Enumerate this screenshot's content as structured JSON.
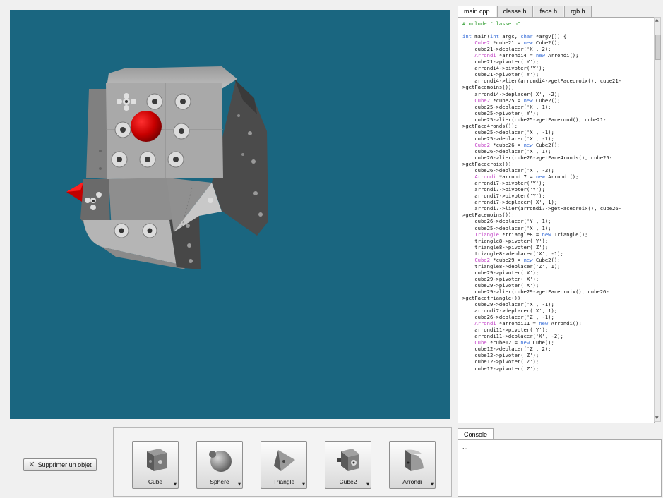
{
  "editor": {
    "tabs": [
      {
        "label": "main.cpp",
        "active": true
      },
      {
        "label": "classe.h",
        "active": false
      },
      {
        "label": "face.h",
        "active": false
      },
      {
        "label": "rgb.h",
        "active": false
      }
    ],
    "code_lines": [
      "#include \"classe.h\"",
      "",
      "int main(int argc, char *argv[]) {",
      "    Cube2 *cube21 = new Cube2();",
      "    cube21->deplacer('X', 2);",
      "    Arrondi *arrondi4 = new Arrondi();",
      "    cube21->pivoter('Y');",
      "    arrondi4->pivoter('Y');",
      "    cube21->pivoter('Y');",
      "    arrondi4->lier(arrondi4->getFacecroix(), cube21-",
      ">getFacemoins());",
      "    arrondi4->deplacer('X', -2);",
      "    Cube2 *cube25 = new Cube2();",
      "    cube25->deplacer('X', 1);",
      "    cube25->pivoter('Y');",
      "    cube25->lier(cube25->getFacerond(), cube21-",
      ">getFace4ronds());",
      "    cube25->deplacer('X', -1);",
      "    cube25->deplacer('X', -1);",
      "    Cube2 *cube26 = new Cube2();",
      "    cube26->deplacer('X', 1);",
      "    cube26->lier(cube26->getFace4ronds(), cube25-",
      ">getFacecroix());",
      "    cube26->deplacer('X', -2);",
      "    Arrondi *arrondi7 = new Arrondi();",
      "    arrondi7->pivoter('Y');",
      "    arrondi7->pivoter('Y');",
      "    arrondi7->pivoter('Y');",
      "    arrondi7->deplacer('X', 1);",
      "    arrondi7->lier(arrondi7->getFacecroix(), cube26-",
      ">getFacemoins());",
      "    cube26->deplacer('Y', 1);",
      "    cube25->deplacer('X', 1);",
      "    Triangle *triangle8 = new Triangle();",
      "    triangle8->pivoter('Y');",
      "    triangle8->pivoter('Z');",
      "    triangle8->deplacer('X', -1);",
      "    Cube2 *cube29 = new Cube2();",
      "    triangle8->deplacer('Z', 1);",
      "    cube29->pivoter('X');",
      "    cube29->pivoter('X');",
      "    cube29->pivoter('X');",
      "    cube29->lier(cube29->getFacecroix(), cube26-",
      ">getFacetriangle());",
      "    cube29->deplacer('X', -1);",
      "    arrondi7->deplacer('X', 1);",
      "    cube26->deplacer('Z', -1);",
      "    Arrondi *arrondi11 = new Arrondi();",
      "    arrondi11->pivoter('Y');",
      "    arrondi11->deplacer('X', -2);",
      "    Cube *cube12 = new Cube();",
      "    cube12->deplacer('Z', 2);",
      "    cube12->pivoter('Z');",
      "    cube12->pivoter('Z');",
      "    cube12->pivoter('Z');"
    ]
  },
  "console": {
    "tab_label": "Console",
    "text": "..."
  },
  "toolbar": {
    "delete_label": "Supprimer un objet"
  },
  "palette": {
    "items": [
      {
        "label": "Cube",
        "icon": "cube-icon"
      },
      {
        "label": "Sphere",
        "icon": "sphere-icon"
      },
      {
        "label": "Triangle",
        "icon": "triangle-icon"
      },
      {
        "label": "Cube2",
        "icon": "cube2-icon"
      },
      {
        "label": "Arrondi",
        "icon": "arrondi-icon"
      }
    ]
  },
  "colors": {
    "viewport_bg": "#1a6680",
    "keyword_type": "#c33fc7",
    "keyword_new": "#3a6fd8",
    "preprocessor": "#2a9a2a"
  }
}
